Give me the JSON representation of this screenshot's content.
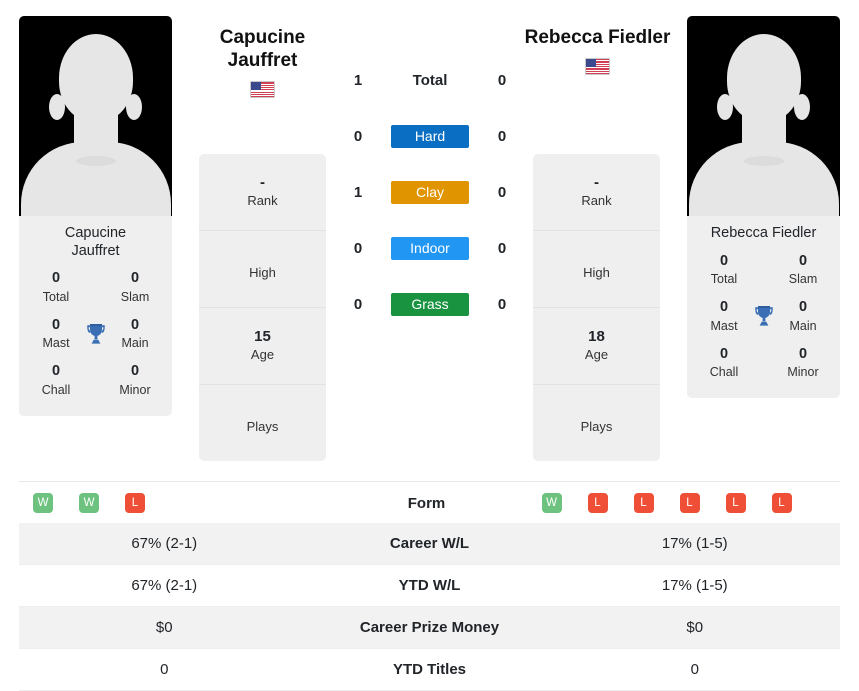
{
  "players": {
    "left": {
      "header_name": "Capucine\nJauffret",
      "header_name_line1": "Capucine",
      "header_name_line2": "Jauffret",
      "flag": "US",
      "card_name_line1": "Capucine",
      "card_name_line2": "Jauffret",
      "titles": {
        "total_value": "0",
        "total_label": "Total",
        "slam_value": "0",
        "slam_label": "Slam",
        "mast_value": "0",
        "mast_label": "Mast",
        "main_value": "0",
        "main_label": "Main",
        "chall_value": "0",
        "chall_label": "Chall",
        "minor_value": "0",
        "minor_label": "Minor"
      },
      "info": [
        {
          "value": "-",
          "label": "Rank"
        },
        {
          "value": "",
          "label": "High"
        },
        {
          "value": "15",
          "label": "Age"
        },
        {
          "value": "",
          "label": "Plays"
        }
      ],
      "form": [
        "W",
        "W",
        "L"
      ]
    },
    "right": {
      "header_name": "Rebecca Fiedler",
      "flag": "US",
      "card_name_line1": "Rebecca Fiedler",
      "titles": {
        "total_value": "0",
        "total_label": "Total",
        "slam_value": "0",
        "slam_label": "Slam",
        "mast_value": "0",
        "mast_label": "Mast",
        "main_value": "0",
        "main_label": "Main",
        "chall_value": "0",
        "chall_label": "Chall",
        "minor_value": "0",
        "minor_label": "Minor"
      },
      "info": [
        {
          "value": "-",
          "label": "Rank"
        },
        {
          "value": "",
          "label": "High"
        },
        {
          "value": "18",
          "label": "Age"
        },
        {
          "value": "",
          "label": "Plays"
        }
      ],
      "form": [
        "W",
        "L",
        "L",
        "L",
        "L",
        "L"
      ]
    }
  },
  "surfaces": [
    {
      "label": "Total",
      "left": "1",
      "right": "0",
      "color": "none"
    },
    {
      "label": "Hard",
      "left": "0",
      "right": "0",
      "color": "#0a6fc2"
    },
    {
      "label": "Clay",
      "left": "1",
      "right": "0",
      "color": "#e09400"
    },
    {
      "label": "Indoor",
      "left": "0",
      "right": "0",
      "color": "#2196f3"
    },
    {
      "label": "Grass",
      "left": "0",
      "right": "0",
      "color": "#1a9340"
    }
  ],
  "form_row": {
    "label": "Form",
    "win_color": "#6cc27e",
    "loss_color": "#ee4f36"
  },
  "stats_table": [
    {
      "label": "Career W/L",
      "left": "67% (2-1)",
      "right": "17% (1-5)"
    },
    {
      "label": "YTD W/L",
      "left": "67% (2-1)",
      "right": "17% (1-5)"
    },
    {
      "label": "Career Prize Money",
      "left": "$0",
      "right": "$0"
    },
    {
      "label": "YTD Titles",
      "left": "0",
      "right": "0"
    }
  ],
  "icons": {
    "trophy": "trophy-icon",
    "flag": "us-flag-icon"
  },
  "theme": {
    "card_bg": "#efefef",
    "stripe_bg": "#f2f2f2",
    "trophy_color": "#3a6fb5",
    "text": "#212529"
  }
}
